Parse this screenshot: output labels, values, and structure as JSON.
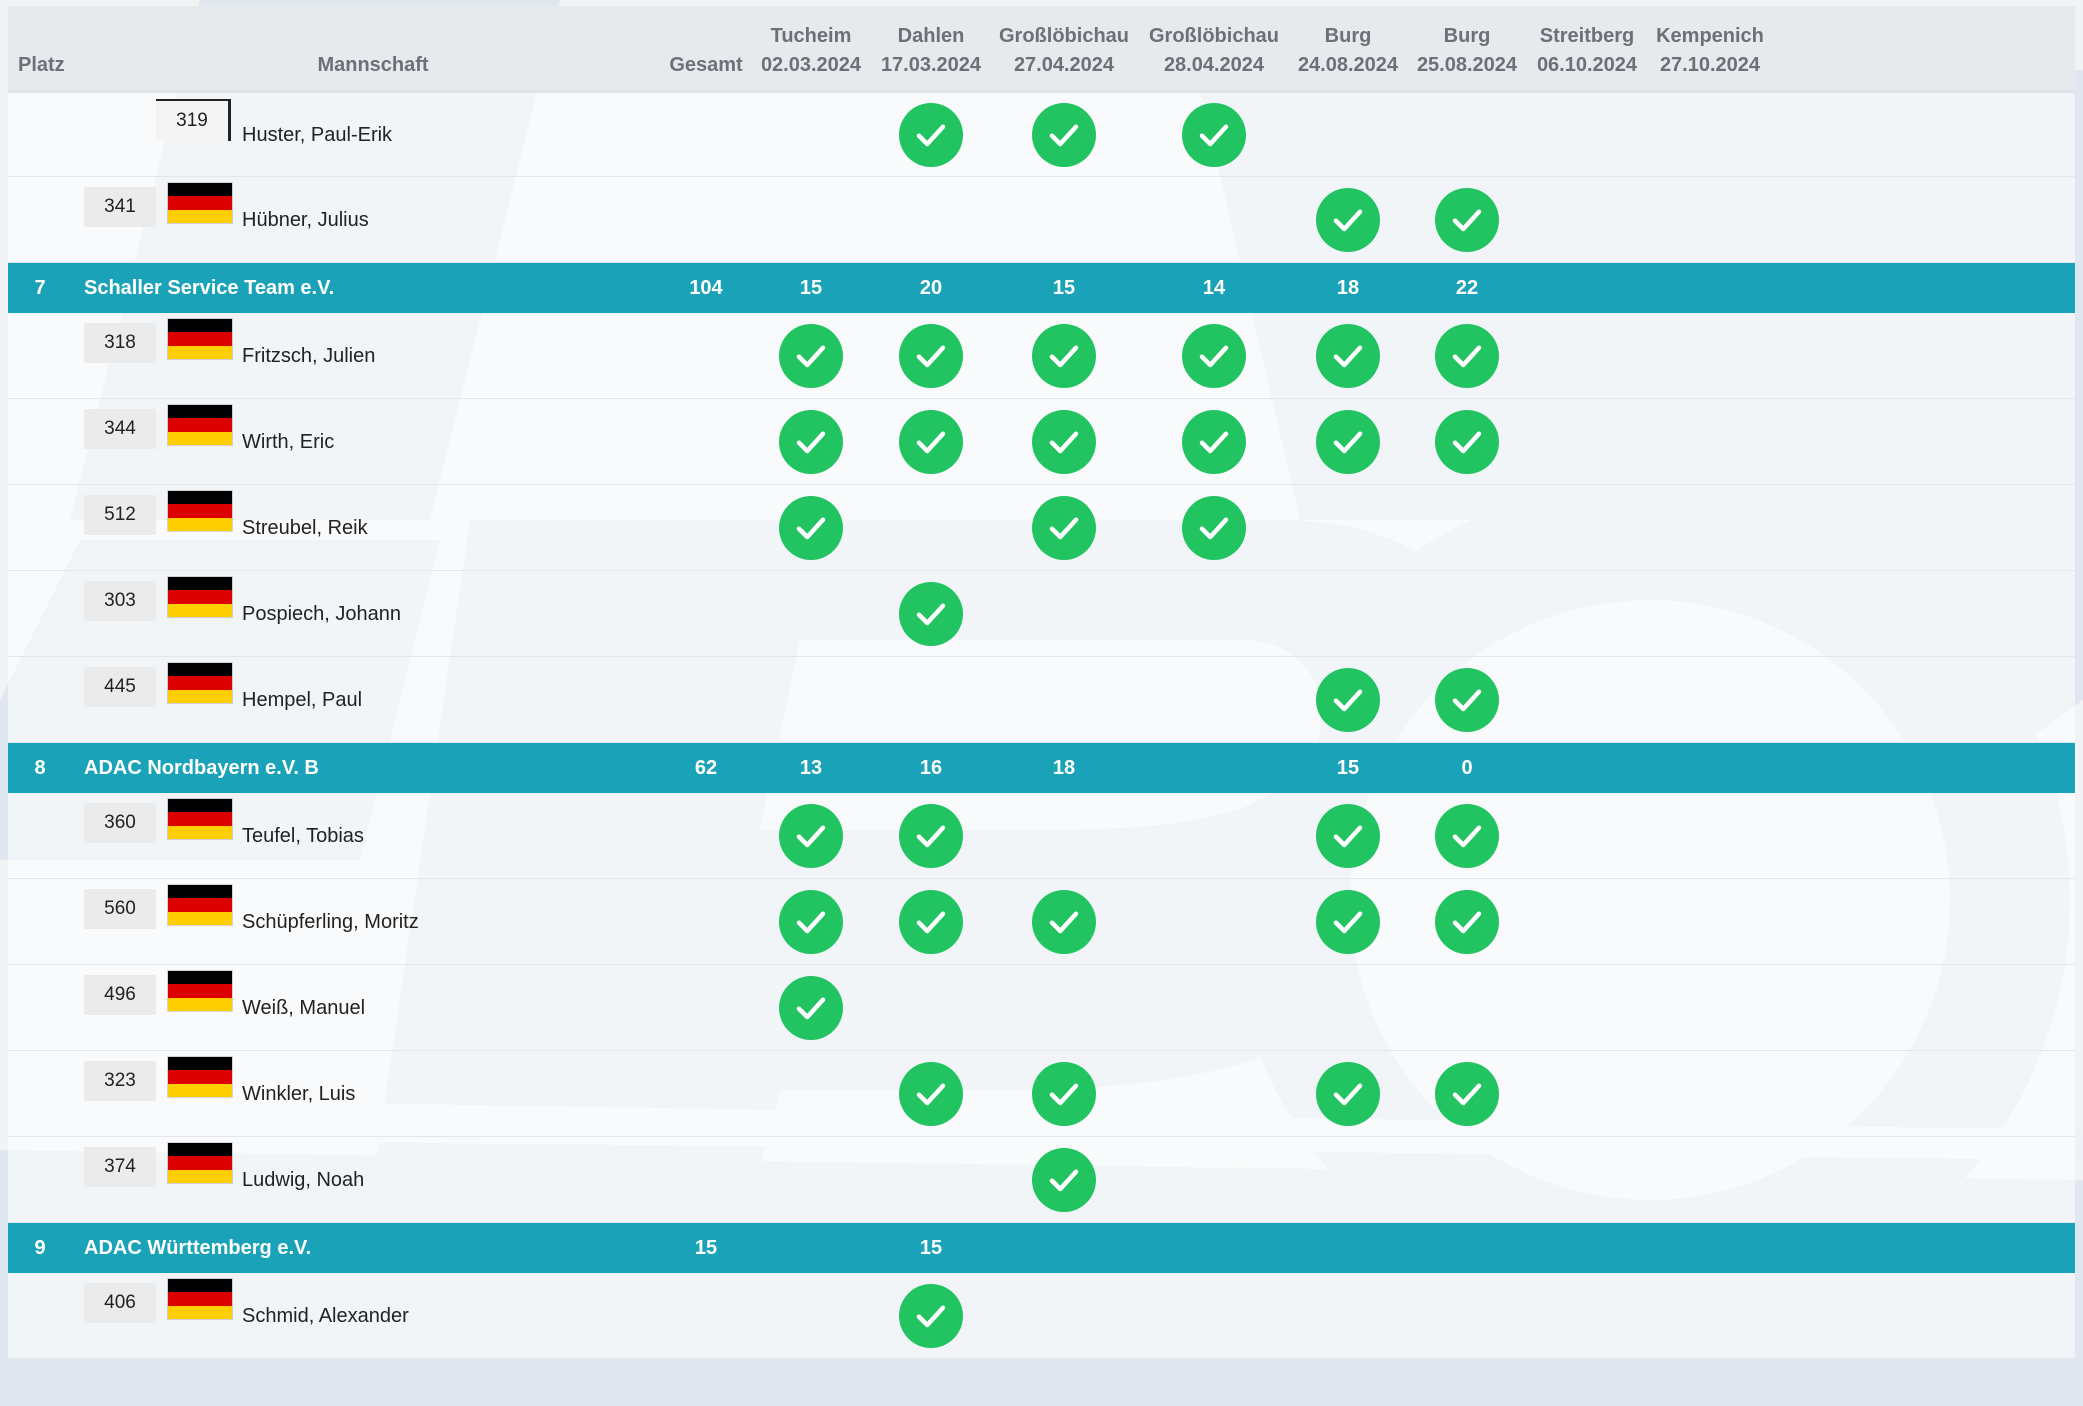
{
  "header": {
    "platz": "Platz",
    "mannschaft": "Mannschaft",
    "gesamt": "Gesamt",
    "events": [
      {
        "loc": "Tucheim",
        "date": "02.03.2024"
      },
      {
        "loc": "Dahlen",
        "date": "17.03.2024"
      },
      {
        "loc": "Großlöbichau",
        "date": "27.04.2024"
      },
      {
        "loc": "Großlöbichau",
        "date": "28.04.2024"
      },
      {
        "loc": "Burg",
        "date": "24.08.2024"
      },
      {
        "loc": "Burg",
        "date": "25.08.2024"
      },
      {
        "loc": "Streitberg",
        "date": "06.10.2024"
      },
      {
        "loc": "Kempenich",
        "date": "27.10.2024"
      }
    ]
  },
  "colors": {
    "team_row": "#1aa3b8",
    "check": "#21c461",
    "header_bg": "#e7eaed"
  },
  "icons": {
    "check": "check-circle-icon",
    "flag": "german-flag-icon"
  },
  "groups": [
    {
      "team": null,
      "riders": [
        {
          "num": "319",
          "name": "Huster, Paul-Erik",
          "flag": false,
          "checks": [
            false,
            true,
            true,
            true,
            false,
            false,
            false,
            false
          ]
        },
        {
          "num": "341",
          "name": "Hübner, Julius",
          "flag": true,
          "checks": [
            false,
            false,
            false,
            false,
            true,
            true,
            false,
            false
          ]
        }
      ]
    },
    {
      "team": {
        "place": "7",
        "name": "Schaller Service Team e.V.",
        "total": "104",
        "scores": [
          "15",
          "20",
          "15",
          "14",
          "18",
          "22",
          "",
          ""
        ]
      },
      "riders": [
        {
          "num": "318",
          "name": "Fritzsch, Julien",
          "flag": true,
          "checks": [
            true,
            true,
            true,
            true,
            true,
            true,
            false,
            false
          ]
        },
        {
          "num": "344",
          "name": "Wirth, Eric",
          "flag": true,
          "checks": [
            true,
            true,
            true,
            true,
            true,
            true,
            false,
            false
          ]
        },
        {
          "num": "512",
          "name": "Streubel, Reik",
          "flag": true,
          "checks": [
            true,
            false,
            true,
            true,
            false,
            false,
            false,
            false
          ]
        },
        {
          "num": "303",
          "name": "Pospiech, Johann",
          "flag": true,
          "checks": [
            false,
            true,
            false,
            false,
            false,
            false,
            false,
            false
          ]
        },
        {
          "num": "445",
          "name": "Hempel, Paul",
          "flag": true,
          "checks": [
            false,
            false,
            false,
            false,
            true,
            true,
            false,
            false
          ]
        }
      ]
    },
    {
      "team": {
        "place": "8",
        "name": "ADAC Nordbayern e.V. B",
        "total": "62",
        "scores": [
          "13",
          "16",
          "18",
          "",
          "15",
          "0",
          "",
          ""
        ]
      },
      "riders": [
        {
          "num": "360",
          "name": "Teufel, Tobias",
          "flag": true,
          "checks": [
            true,
            true,
            false,
            false,
            true,
            true,
            false,
            false
          ]
        },
        {
          "num": "560",
          "name": "Schüpferling, Moritz",
          "flag": true,
          "checks": [
            true,
            true,
            true,
            false,
            true,
            true,
            false,
            false
          ]
        },
        {
          "num": "496",
          "name": "Weiß, Manuel",
          "flag": true,
          "checks": [
            true,
            false,
            false,
            false,
            false,
            false,
            false,
            false
          ]
        },
        {
          "num": "323",
          "name": "Winkler, Luis",
          "flag": true,
          "checks": [
            false,
            true,
            true,
            false,
            true,
            true,
            false,
            false
          ]
        },
        {
          "num": "374",
          "name": "Ludwig, Noah",
          "flag": true,
          "checks": [
            false,
            false,
            true,
            false,
            false,
            false,
            false,
            false
          ]
        }
      ]
    },
    {
      "team": {
        "place": "9",
        "name": "ADAC Württemberg e.V.",
        "total": "15",
        "scores": [
          "",
          "15",
          "",
          "",
          "",
          "",
          "",
          ""
        ]
      },
      "riders": [
        {
          "num": "406",
          "name": "Schmid, Alexander",
          "flag": true,
          "checks": [
            false,
            true,
            false,
            false,
            false,
            false,
            false,
            false
          ]
        }
      ]
    }
  ]
}
